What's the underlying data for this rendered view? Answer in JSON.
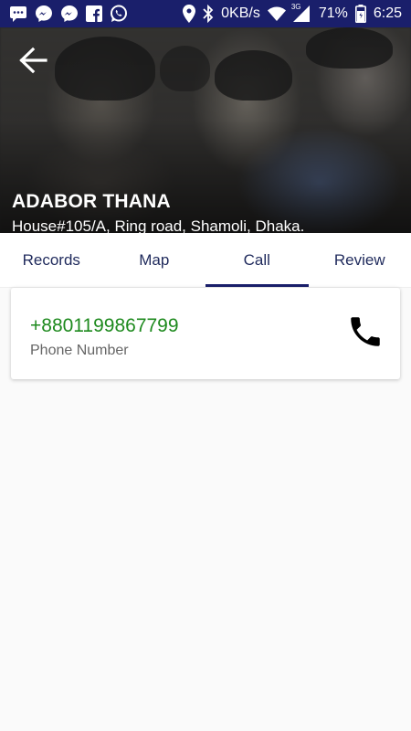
{
  "status_bar": {
    "network_speed": "0KB/s",
    "network_type": "3G",
    "battery": "71%",
    "time": "6:25",
    "icons_left": [
      "messages-icon",
      "messenger-icon",
      "messenger-icon",
      "facebook-icon",
      "whatsapp-icon"
    ],
    "icons_right": [
      "location-icon",
      "bluetooth-icon",
      "wifi-icon",
      "signal-icon",
      "battery-icon"
    ]
  },
  "header": {
    "title": "ADABOR THANA",
    "address": "House#105/A, Ring road, Shamoli, Dhaka."
  },
  "tabs": [
    {
      "label": "Records",
      "active": false
    },
    {
      "label": "Map",
      "active": false
    },
    {
      "label": "Call",
      "active": true
    },
    {
      "label": "Review",
      "active": false
    }
  ],
  "call_card": {
    "phone": "+8801199867799",
    "label": "Phone Number"
  },
  "colors": {
    "primary": "#1a1f6b",
    "phone_green": "#1e8a1e"
  }
}
